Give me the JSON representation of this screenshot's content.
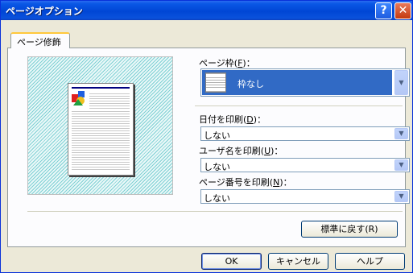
{
  "window": {
    "title": "ページオプション",
    "help_glyph": "?",
    "close_glyph": "✕"
  },
  "tab": {
    "label": "ページ修飾"
  },
  "page_frame": {
    "label": "ページ枠(",
    "mnemonic": "F",
    "suffix": ")：",
    "value": "枠なし"
  },
  "print_date": {
    "label": "日付を印刷(",
    "mnemonic": "D",
    "suffix": ")：",
    "value": "しない"
  },
  "print_user": {
    "label": "ユーザ名を印刷(",
    "mnemonic": "U",
    "suffix": ")：",
    "value": "しない"
  },
  "print_page_number": {
    "label": "ページ番号を印刷(",
    "mnemonic": "N",
    "suffix": ")：",
    "value": "しない"
  },
  "buttons": {
    "reset": "標準に戻す(R)",
    "ok": "OK",
    "cancel": "キャンセル",
    "help": "ヘルプ"
  },
  "icons": {
    "dropdown": "▼",
    "preview_shapes": "page-preview-icon"
  },
  "colors": {
    "selection": "#316ac5",
    "title_bar": "#0046d5",
    "tab_highlight": "#ffc83c"
  }
}
